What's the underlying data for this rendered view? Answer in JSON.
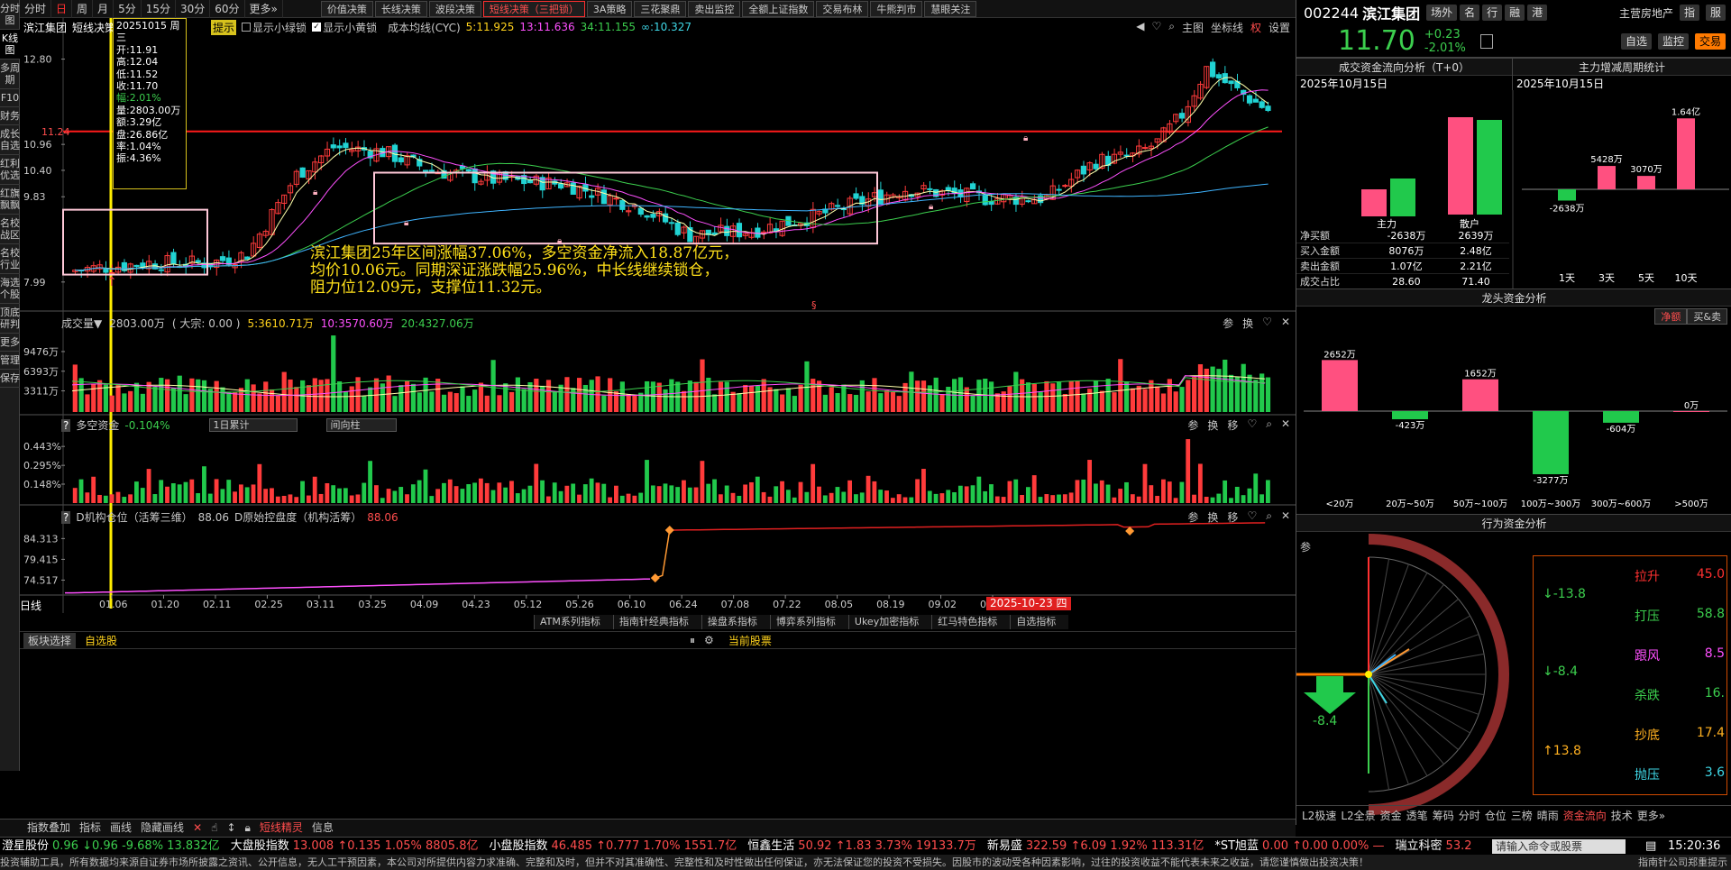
{
  "sidebar": [
    "分时图",
    "K线图",
    "多周期",
    "F10",
    "财务",
    "成长自选",
    "红利优选",
    "红旗飘飘",
    "名校战区",
    "名校行业",
    "海选个股",
    "顶底研判",
    "更多",
    "管理",
    "保存"
  ],
  "topbar": {
    "periods": [
      "分时",
      "日",
      "周",
      "月",
      "5分",
      "15分",
      "30分",
      "60分",
      "更多»"
    ],
    "strategies": [
      "价值决策",
      "长线决策",
      "波段决策",
      "短线决策（三把锁）",
      "3A策略",
      "三花聚鼎",
      "卖出监控",
      "全额上证指数",
      "交易布林",
      "牛熊判市",
      "慧眼关注"
    ]
  },
  "chart_header": {
    "stock": "滨江集团",
    "indicator": "短线决策",
    "hint": "提示",
    "green_box": "显示小绿锁",
    "yellow_box": "显示小黄锁",
    "cyc_title": "成本均线(CYC)",
    "cyc5": "5:11.925",
    "cyc13": "13:11.636",
    "cyc34": "34:11.155",
    "cyc_inf": "∞:10.327",
    "ctl": [
      "主图",
      "坐标线",
      "权",
      "设置"
    ]
  },
  "price_axis": [
    "12.80",
    "10.96",
    "10.40",
    "9.83",
    "7.99"
  ],
  "red_line_label": "11.24",
  "info_box": {
    "date": "20251015 周三",
    "rows": [
      "开:11.91",
      "高:12.04",
      "低:11.52",
      "收:11.70",
      "幅:2.01%",
      "量:2803.00万",
      "额:3.29亿",
      "盘:26.86亿",
      "率:1.04%",
      "振:4.36%"
    ]
  },
  "annotation": [
    "滨江集团25年区间涨幅37.06%，多空资金净流入18.87亿元，",
    "均价10.06元。同期深证涨跌幅25.96%，中长线继续锁仓，",
    "阻力位12.09元，支撑位11.32元。"
  ],
  "volume_panel": {
    "title": "成交量▼",
    "v": "2803.00万",
    "big": "( 大宗: 0.00 )",
    "ma5": "5:3610.71万",
    "ma10": "10:3570.60万",
    "ma20": "20:4327.06万",
    "axis": [
      "9476万",
      "6393万",
      "3311万"
    ]
  },
  "dk_panel": {
    "title": "多空资金",
    "value": "-0.104%",
    "sel1": "1日累计",
    "sel2": "间向柱",
    "axis": [
      "0.443%",
      "0.295%",
      "0.148%"
    ]
  },
  "inst_panel": {
    "title": "D机构仓位（活筹三维）",
    "v1": "88.06",
    "t2": "D原始控盘度（机构活筹）",
    "v2": "88.06",
    "axis": [
      "84.313",
      "79.415",
      "74.517"
    ]
  },
  "panel_ctl": [
    "参",
    "换",
    "移"
  ],
  "xaxis": {
    "label": "日线",
    "dates": [
      "01.06",
      "01.20",
      "02.11",
      "02.25",
      "03.11",
      "03.25",
      "04.09",
      "04.23",
      "05.12",
      "05.26",
      "06.10",
      "06.24",
      "07.08",
      "07.22",
      "08.05",
      "08.19",
      "09.02",
      "09.16"
    ],
    "end": "2025-10-23 四"
  },
  "indicator_tabs": [
    "ATM系列指标",
    "指南针经典指标",
    "操盘系指标",
    "博弈系列指标",
    "Ukey加密指标",
    "红马特色指标",
    "自选指标"
  ],
  "block": {
    "select": "板块选择",
    "self": "自选股",
    "current": "当前股票"
  },
  "bottom_tools": [
    "指数叠加",
    "指标",
    "画线",
    "隐藏画线",
    "短线精灵",
    "信息"
  ],
  "right": {
    "code": "002244",
    "name": "滨江集团",
    "btns": [
      "场外",
      "名",
      "行",
      "融",
      "港"
    ],
    "sector": "主营房地产",
    "idx": "指",
    "hu": "服",
    "price": "11.70",
    "chg": "+0.23",
    "pct": "-2.01%",
    "actions": [
      "自选",
      "监控",
      "交易"
    ],
    "flow_title": "成交资金流向分析（T+0）",
    "flow_date": "2025年10月15日",
    "main_title": "主力增减周期统计",
    "main_date": "2025年10月15日",
    "flow_cols": [
      "主力",
      "散户"
    ],
    "flow_rows": [
      [
        "净买额",
        "-2638万",
        "2639万"
      ],
      [
        "买入金额",
        "8076万",
        "2.48亿"
      ],
      [
        "卖出金额",
        "1.07亿",
        "2.21亿"
      ],
      [
        "成交占比",
        "28.60",
        "71.40"
      ]
    ],
    "period_vals": [
      "-2638万",
      "5428万",
      "3070万",
      "1.64亿"
    ],
    "period_labels": [
      "1天",
      "3天",
      "5天",
      "10天"
    ],
    "dragon_title": "龙头资金分析",
    "dragon_tabs": [
      "净额",
      "买&卖"
    ],
    "dragon_vals": [
      "2652万",
      "-423万",
      "1652万",
      "-3277万",
      "-604万",
      "0万"
    ],
    "dragon_labels": [
      "<20万",
      "20万~50万",
      "50万~100万",
      "100万~300万",
      "300万~600万",
      ">500万"
    ],
    "behavior_title": "行为资金分析",
    "beh_left": [
      "↓-13.8",
      "↓-8.4",
      "↑13.8"
    ],
    "beh_right": [
      [
        "拉升",
        "45.0"
      ],
      [
        "打压",
        "58.8"
      ],
      [
        "跟风",
        "8.5"
      ],
      [
        "杀跌",
        "16."
      ],
      [
        "抄底",
        "17.4"
      ],
      [
        "抛压",
        "3.6"
      ]
    ],
    "dial_val": "-8.4",
    "beh_label": "参",
    "bottom_tabs": [
      "L2极速",
      "L2全景",
      "资金",
      "透笔",
      "筹码",
      "分时",
      "仓位",
      "三榜",
      "晴雨",
      "资金流向",
      "技术",
      "更多»"
    ]
  },
  "ticker": [
    {
      "name": "澄星股份",
      "vals": "0.96 ↓0.96 -9.68% 13.832亿"
    },
    {
      "name": "大盘股指数",
      "vals": "13.008 ↑0.135 1.05% 8805.8亿"
    },
    {
      "name": "小盘股指数",
      "vals": "46.485 ↑0.777 1.70% 1551.7亿"
    },
    {
      "name": "恒鑫生活",
      "vals": "50.92 ↑1.83 3.73% 19133.7万"
    },
    {
      "name": "新易盛",
      "vals": "322.59 ↑6.09 1.92% 113.31亿"
    },
    {
      "name": "*ST旭蓝",
      "vals": "0.00 ↑0.00 0.00% —"
    },
    {
      "name": "瑞立科密",
      "vals": "53.2"
    }
  ],
  "command_placeholder": "请输入命令或股票",
  "clock": "15:20:36",
  "disclaimer": "投资辅助工具，所有数据均来源自证券市场所披露之资讯、公开信息，无人工干预因素，本公司对所提供内容力求准确、完整和及时，但并不对其准确性、完整性和及时性做出任何保证，亦无法保证您的投资不受损失。因股市的波动受各种因素影响，过往的投资收益不能代表未来之收益，请您谨慎做出投资决策！",
  "disclaimer_right": "指南针公司郑重提示"
}
